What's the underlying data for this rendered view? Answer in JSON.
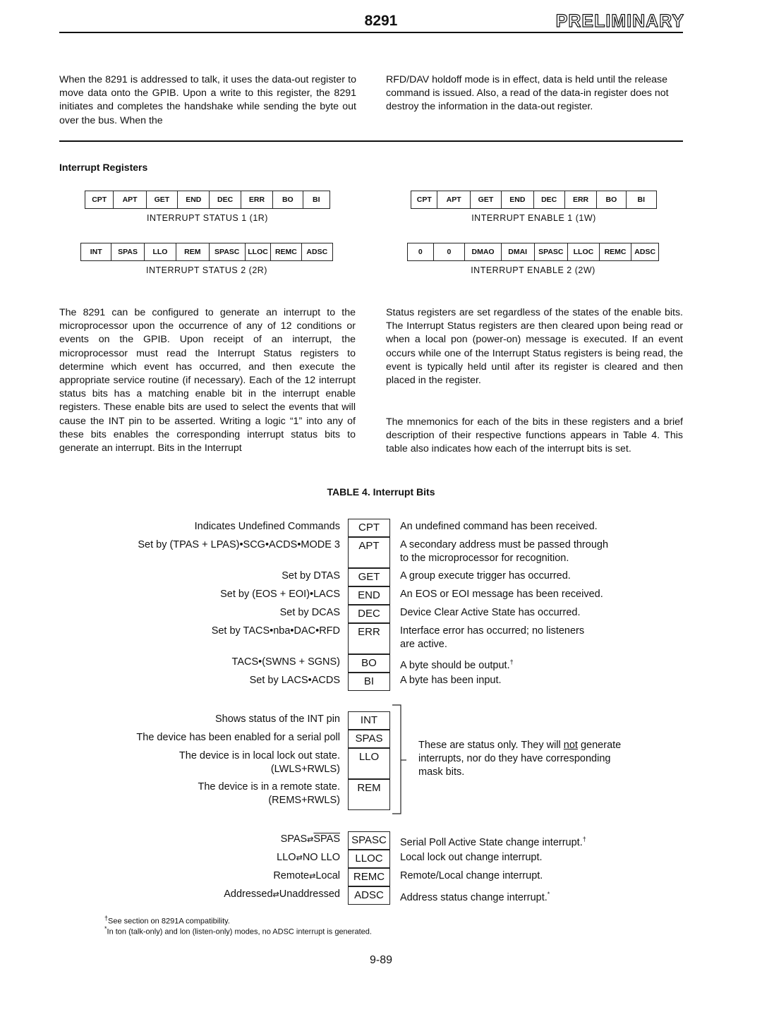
{
  "header": {
    "chip": "8291",
    "stamp": "PRELIMINARY"
  },
  "intro": {
    "left": "When the 8291 is addressed to talk, it uses the data-out register to move data onto the GPIB. Upon a write to this register, the 8291 initiates and completes the handshake while sending the byte out over the bus. When the",
    "right": "RFD/DAV holdoff mode is in effect, data is held until the release command is issued. Also, a read of the data-in register does not destroy the information in the data-out register."
  },
  "section_title": "Interrupt Registers",
  "registers": [
    {
      "caption": "INTERRUPT STATUS 1 (1R)",
      "bits": [
        "CPT",
        "APT",
        "GET",
        "END",
        "DEC",
        "ERR",
        "BO",
        "BI"
      ]
    },
    {
      "caption": "INTERRUPT ENABLE 1 (1W)",
      "bits": [
        "CPT",
        "APT",
        "GET",
        "END",
        "DEC",
        "ERR",
        "BO",
        "BI"
      ]
    },
    {
      "caption": "INTERRUPT STATUS 2 (2R)",
      "bits": [
        "INT",
        "SPAS",
        "LLO",
        "REM",
        "SPASC",
        "LLOC",
        "REMC",
        "ADSC"
      ]
    },
    {
      "caption": "INTERRUPT ENABLE 2 (2W)",
      "bits": [
        "0",
        "0",
        "DMAO",
        "DMAI",
        "SPASC",
        "LLOC",
        "REMC",
        "ADSC"
      ]
    }
  ],
  "body": {
    "left": "The 8291 can be configured to generate an interrupt to the microprocessor upon the occurrence of any of 12 conditions or events on the GPIB. Upon receipt of an interrupt, the microprocessor must read the Interrupt Status registers to determine which event has occurred, and then execute the appropriate service routine (if necessary). Each of the 12 interrupt status bits has a matching enable bit in the interrupt enable registers. These enable bits are used to select the events that will cause the INT pin to be asserted. Writing a logic “1” into any of these bits enables the corresponding interrupt status bits to generate an interrupt. Bits in the Interrupt",
    "right_1": "Status registers are set regardless of the states of the enable bits. The Interrupt Status registers are then cleared upon being read or when a local pon (power-on) message is executed. If an event occurs while one of the Interrupt Status registers is being read, the event is typically held until after its register is cleared and then placed in the register.",
    "right_2": "The mnemonics for each of the bits in these registers and a brief description of their respective functions appears in Table 4. This table also indicates how each of the interrupt bits is set."
  },
  "table": {
    "title": "TABLE 4. Interrupt Bits",
    "group1": [
      {
        "label": "Indicates Undefined Commands",
        "mnemonic": "CPT",
        "desc": "An undefined command has been received."
      },
      {
        "label": "Set by (TPAS + LPAS)•SCG•ACDS•MODE 3",
        "mnemonic": "APT",
        "desc": "A secondary address must be passed through",
        "desc2": "to the microprocessor for recognition."
      },
      {
        "label": "Set by DTAS",
        "mnemonic": "GET",
        "desc": "A group execute trigger has occurred."
      },
      {
        "label": "Set by (EOS + EOI)•LACS",
        "mnemonic": "END",
        "desc": "An EOS or EOI message has been received."
      },
      {
        "label": "Set by DCAS",
        "mnemonic": "DEC",
        "desc": "Device Clear Active State has occurred."
      },
      {
        "label": "Set by TACS•nba•DAC•RFD",
        "mnemonic": "ERR",
        "desc": "Interface error has occurred; no listeners",
        "desc2": "are active."
      },
      {
        "label": "TACS•(SWNS + SGNS)",
        "mnemonic": "BO",
        "desc": "A byte should be output.",
        "mark": "†"
      },
      {
        "label": "Set by LACS•ACDS",
        "mnemonic": "BI",
        "desc": "A byte has been input."
      }
    ],
    "group2": [
      {
        "label": "Shows status of the INT pin",
        "mnemonic": "INT"
      },
      {
        "label": "The device has been enabled for a serial poll",
        "mnemonic": "SPAS"
      },
      {
        "label": "The device is in local lock out state.",
        "label2": "(LWLS+RWLS)",
        "mnemonic": "LLO"
      },
      {
        "label": "The device is in a remote state.",
        "label2": "(REMS+RWLS)",
        "mnemonic": "REM"
      }
    ],
    "group2_note": {
      "pre": "These are status only. They will ",
      "emph": "not",
      "post": " generate",
      "line2": "interrupts, nor do they have corresponding",
      "line3": "mask bits."
    },
    "group3": [
      {
        "a": "SPAS",
        "b": "SPAS",
        "b_overline": true,
        "mnemonic": "SPASC",
        "desc": "Serial Poll Active State change interrupt.",
        "mark": "†"
      },
      {
        "a": "LLO",
        "b": "NO LLO",
        "mnemonic": "LLOC",
        "desc": "Local lock out change interrupt."
      },
      {
        "a": "Remote",
        "b": "Local",
        "mnemonic": "REMC",
        "desc": "Remote/Local change interrupt."
      },
      {
        "a": "Addressed",
        "b": "Unaddressed",
        "mnemonic": "ADSC",
        "desc": "Address status change interrupt.",
        "mark": "*"
      }
    ]
  },
  "footnotes": [
    {
      "mark": "†",
      "text": "See section on 8291A compatibility."
    },
    {
      "mark": "*",
      "text": "In ton (talk-only) and lon (listen-only) modes, no ADSC interrupt is generated."
    }
  ],
  "page_number": "9-89"
}
